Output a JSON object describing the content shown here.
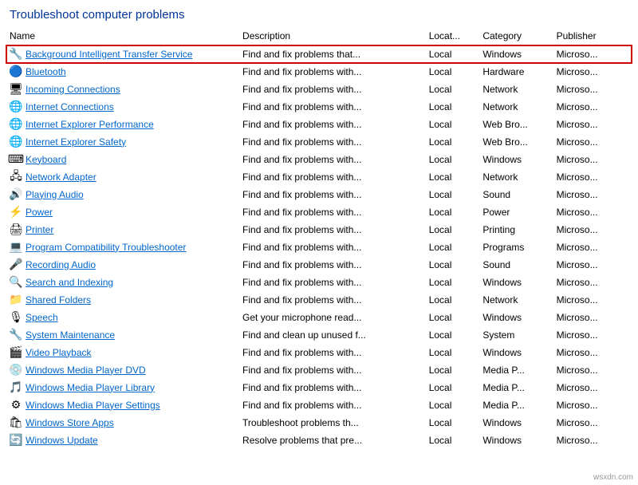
{
  "page": {
    "title": "Troubleshoot computer problems"
  },
  "columns": [
    {
      "key": "name",
      "label": "Name"
    },
    {
      "key": "description",
      "label": "Description"
    },
    {
      "key": "location",
      "label": "Locat..."
    },
    {
      "key": "category",
      "label": "Category"
    },
    {
      "key": "publisher",
      "label": "Publisher"
    }
  ],
  "rows": [
    {
      "name": "Background Intelligent Transfer Service",
      "description": "Find and fix problems that...",
      "location": "Local",
      "category": "Windows",
      "publisher": "Microso...",
      "selected": true,
      "icon": "🔧",
      "iconType": "bits"
    },
    {
      "name": "Bluetooth",
      "description": "Find and fix problems with...",
      "location": "Local",
      "category": "Hardware",
      "publisher": "Microso...",
      "selected": false,
      "icon": "🔵",
      "iconType": "blue"
    },
    {
      "name": "Incoming Connections",
      "description": "Find and fix problems with...",
      "location": "Local",
      "category": "Network",
      "publisher": "Microso...",
      "selected": false,
      "icon": "🖥",
      "iconType": "blue"
    },
    {
      "name": "Internet Connections",
      "description": "Find and fix problems with...",
      "location": "Local",
      "category": "Network",
      "publisher": "Microso...",
      "selected": false,
      "icon": "🌐",
      "iconType": "blue"
    },
    {
      "name": "Internet Explorer Performance",
      "description": "Find and fix problems with...",
      "location": "Local",
      "category": "Web Bro...",
      "publisher": "Microso...",
      "selected": false,
      "icon": "🌐",
      "iconType": "blue"
    },
    {
      "name": "Internet Explorer Safety",
      "description": "Find and fix problems with...",
      "location": "Local",
      "category": "Web Bro...",
      "publisher": "Microso...",
      "selected": false,
      "icon": "🌐",
      "iconType": "blue"
    },
    {
      "name": "Keyboard",
      "description": "Find and fix problems with...",
      "location": "Local",
      "category": "Windows",
      "publisher": "Microso...",
      "selected": false,
      "icon": "⌨",
      "iconType": "blue"
    },
    {
      "name": "Network Adapter",
      "description": "Find and fix problems with...",
      "location": "Local",
      "category": "Network",
      "publisher": "Microso...",
      "selected": false,
      "icon": "🖧",
      "iconType": "blue"
    },
    {
      "name": "Playing Audio",
      "description": "Find and fix problems with...",
      "location": "Local",
      "category": "Sound",
      "publisher": "Microso...",
      "selected": false,
      "icon": "🔊",
      "iconType": "green"
    },
    {
      "name": "Power",
      "description": "Find and fix problems with...",
      "location": "Local",
      "category": "Power",
      "publisher": "Microso...",
      "selected": false,
      "icon": "⚡",
      "iconType": "orange"
    },
    {
      "name": "Printer",
      "description": "Find and fix problems with...",
      "location": "Local",
      "category": "Printing",
      "publisher": "Microso...",
      "selected": false,
      "icon": "🖨",
      "iconType": "blue"
    },
    {
      "name": "Program Compatibility Troubleshooter",
      "description": "Find and fix problems with...",
      "location": "Local",
      "category": "Programs",
      "publisher": "Microso...",
      "selected": false,
      "icon": "💻",
      "iconType": "blue"
    },
    {
      "name": "Recording Audio",
      "description": "Find and fix problems with...",
      "location": "Local",
      "category": "Sound",
      "publisher": "Microso...",
      "selected": false,
      "icon": "🎤",
      "iconType": "green"
    },
    {
      "name": "Search and Indexing",
      "description": "Find and fix problems with...",
      "location": "Local",
      "category": "Windows",
      "publisher": "Microso...",
      "selected": false,
      "icon": "🔍",
      "iconType": "blue"
    },
    {
      "name": "Shared Folders",
      "description": "Find and fix problems with...",
      "location": "Local",
      "category": "Network",
      "publisher": "Microso...",
      "selected": false,
      "icon": "📁",
      "iconType": "orange"
    },
    {
      "name": "Speech",
      "description": "Get your microphone read...",
      "location": "Local",
      "category": "Windows",
      "publisher": "Microso...",
      "selected": false,
      "icon": "🎙",
      "iconType": "blue"
    },
    {
      "name": "System Maintenance",
      "description": "Find and clean up unused f...",
      "location": "Local",
      "category": "System",
      "publisher": "Microso...",
      "selected": false,
      "icon": "🔧",
      "iconType": "blue"
    },
    {
      "name": "Video Playback",
      "description": "Find and fix problems with...",
      "location": "Local",
      "category": "Windows",
      "publisher": "Microso...",
      "selected": false,
      "icon": "🎬",
      "iconType": "blue"
    },
    {
      "name": "Windows Media Player DVD",
      "description": "Find and fix problems with...",
      "location": "Local",
      "category": "Media P...",
      "publisher": "Microso...",
      "selected": false,
      "icon": "💿",
      "iconType": "blue"
    },
    {
      "name": "Windows Media Player Library",
      "description": "Find and fix problems with...",
      "location": "Local",
      "category": "Media P...",
      "publisher": "Microso...",
      "selected": false,
      "icon": "🎵",
      "iconType": "blue"
    },
    {
      "name": "Windows Media Player Settings",
      "description": "Find and fix problems with...",
      "location": "Local",
      "category": "Media P...",
      "publisher": "Microso...",
      "selected": false,
      "icon": "⚙",
      "iconType": "blue"
    },
    {
      "name": "Windows Store Apps",
      "description": "Troubleshoot problems th...",
      "location": "Local",
      "category": "Windows",
      "publisher": "Microso...",
      "selected": false,
      "icon": "🛍",
      "iconType": "blue"
    },
    {
      "name": "Windows Update",
      "description": "Resolve problems that pre...",
      "location": "Local",
      "category": "Windows",
      "publisher": "Microso...",
      "selected": false,
      "icon": "🔄",
      "iconType": "blue"
    }
  ],
  "watermark": "wsxdn.com"
}
